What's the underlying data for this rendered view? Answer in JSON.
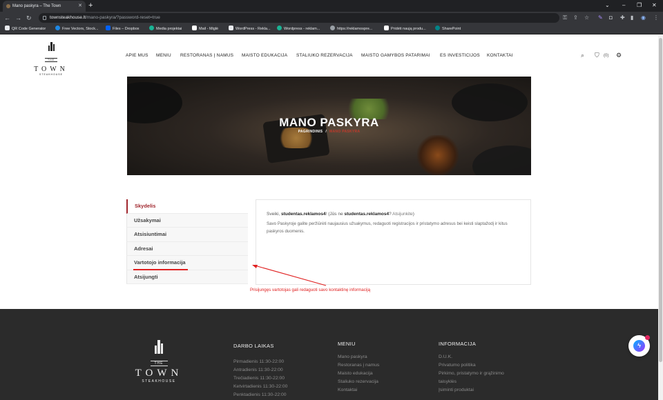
{
  "browser": {
    "tab_title": "Mano paskyra – The Town",
    "url_host": "townsteakhouse.lt",
    "url_path": "/mano-paskyra/?password-reset=true",
    "bookmarks": [
      {
        "label": "QR Code Generator",
        "color": "#e8eaed"
      },
      {
        "label": "Free Vectors, Stock...",
        "color": "#1e88e5"
      },
      {
        "label": "Files – Dropbox",
        "color": "#0061fe"
      },
      {
        "label": "Media projektai",
        "color": "#1ab394"
      },
      {
        "label": "Mail - Miglė",
        "color": "#ffffff"
      },
      {
        "label": "WordPress - Rekla...",
        "color": "#e8eaed"
      },
      {
        "label": "Wordpress - reklam...",
        "color": "#1ab394"
      },
      {
        "label": "https://reklamospre...",
        "color": "#9aa0a6"
      },
      {
        "label": "Pridėti naują produ...",
        "color": "#ffffff"
      },
      {
        "label": "SharePoint",
        "color": "#038387"
      }
    ]
  },
  "header": {
    "logo": {
      "the": "THE",
      "town": "TOWN",
      "steakhouse": "STEAKHOUSE"
    },
    "nav": [
      "APIE MUS",
      "MENIU",
      "RESTORANAS Į NAMUS",
      "MAISTO EDUKACIJA",
      "STALIUKO REZERVACIJA",
      "MAISTO GAMYBOS PATARIMAI",
      "ES INVESTICIJOS",
      "KONTAKTAI"
    ],
    "cart_count": "(0)"
  },
  "banner": {
    "title": "MANO PASKYRA",
    "crumb_home": "PAGRINDINIS",
    "crumb_sep": "/",
    "crumb_current": "MANO PASKYRA"
  },
  "account": {
    "menu": [
      "Skydelis",
      "Užsakymai",
      "Atsisiuntimai",
      "Adresai",
      "Vartotojo informacija",
      "Atsijungti"
    ],
    "greeting_prefix": "Sveiki,",
    "username": "studentas.reklamos4",
    "greeting_mid": "! (Jūs ne",
    "username2": "studentas.reklamos4",
    "greeting_q": "?",
    "logout_link": "Atsijunkite",
    "greeting_end": ")",
    "description": "Savo Paskyroje galite peržiūrėti naujausius užsakymus, redaguoti registracijos ir pristatymo adresus bei keisti slaptažodį ir kitus paskyros duomenis."
  },
  "annotation": {
    "text": "Prisijungęs vartotojas gali redaguoti savo kontaktinę informaciją",
    "color": "#e02020"
  },
  "footer": {
    "logo": {
      "the": "THE",
      "town": "TOWN",
      "steakhouse": "STEAKHOUSE"
    },
    "hours_title": "DARBO LAIKAS",
    "hours": [
      "Pirmadienis 11:30-22:00",
      "Antradienis 11:30-22:00",
      "Trečiadienis 11:30-22:00",
      "Ketvirtadienis 11:30-22:00",
      "Penktadienis 11:30-22:00"
    ],
    "menu_title": "MENIU",
    "menu": [
      "Mano paskyra",
      "Restoranas į namus",
      "Maisto edukacija",
      "Staliuko rezervacija",
      "Kontaktai"
    ],
    "info_title": "INFORMACIJA",
    "info": [
      "D.U.K.",
      "Privatumo politika",
      "Pirkimo, pristatymo ir grąžinimo",
      "taisyklės",
      "Įsiminti produktai"
    ]
  }
}
